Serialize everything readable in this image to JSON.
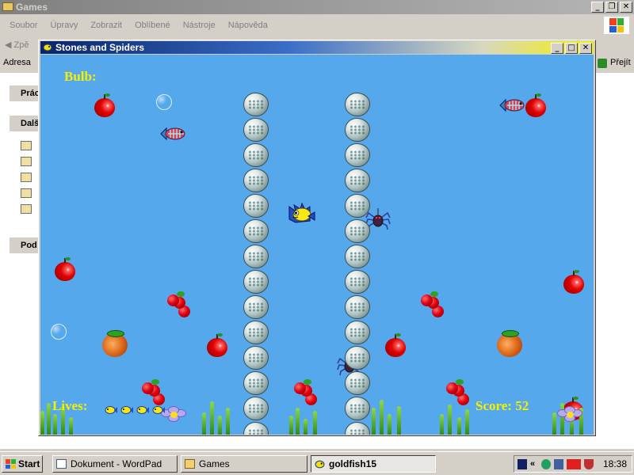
{
  "explorer": {
    "title": "Games",
    "menu": [
      "Soubor",
      "Úpravy",
      "Zobrazit",
      "Oblíbené",
      "Nástroje",
      "Nápověda"
    ],
    "back_label": "Zpě",
    "address_label": "Adresa",
    "go_label": "Přejít",
    "side_sections": [
      "Prác",
      "Dalš",
      "Pod"
    ]
  },
  "game": {
    "title": "Stones and Spiders",
    "bulb_label": "Bulb:",
    "lives_label": "Lives:",
    "lives": 4,
    "score_label": "Score: 52",
    "colors": {
      "water": "#56a8ec",
      "hud": "#f4f000"
    }
  },
  "taskbar": {
    "start_label": "Start",
    "tasks": [
      "Dokument - WordPad",
      "Games",
      "goldfish15"
    ],
    "active_task": "goldfish15",
    "clock": "18:38",
    "tray_icons": [
      "cs-icon",
      "chevron-left-icon",
      "network-icon",
      "display-icon",
      "ati-icon",
      "shield-icon"
    ]
  }
}
